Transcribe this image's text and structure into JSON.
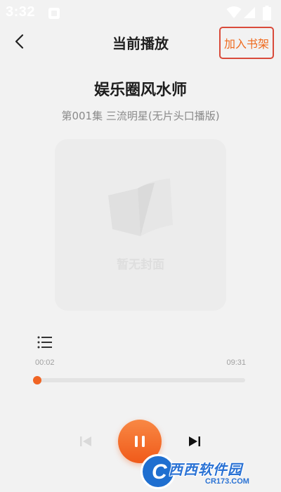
{
  "status_bar": {
    "time": "3:32",
    "icons": [
      "app-notification-icon",
      "wifi-icon",
      "signal-icon",
      "battery-icon"
    ]
  },
  "nav": {
    "title": "当前播放",
    "back_icon": "chevron-left-icon",
    "add_to_shelf_label": "加入书架"
  },
  "book": {
    "title": "娱乐圈风水师",
    "episode": "第001集 三流明星(无片头口播版)",
    "cover_placeholder": "暂无封面",
    "cover_icon": "open-book-icon"
  },
  "player": {
    "playlist_icon": "playlist-icon",
    "current_time": "00:02",
    "total_time": "09:31",
    "progress": 0.0035,
    "prev_icon": "skip-previous-icon",
    "prev_enabled": false,
    "play_state_icon": "pause-icon",
    "next_icon": "skip-next-icon"
  },
  "watermark": {
    "title": "西西软件园",
    "url": "CR173.COM"
  },
  "colors": {
    "accent": "#f06423",
    "background": "#f2f2f2",
    "highlight_border": "#d94a3a",
    "watermark_blue": "#2a72d4"
  }
}
